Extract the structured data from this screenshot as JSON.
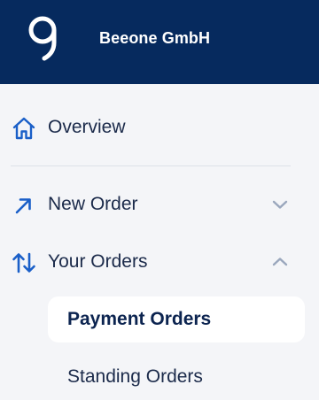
{
  "header": {
    "company_name": "Beeone GmbH",
    "logo_icon": "beeone-logo-icon"
  },
  "nav": {
    "items": [
      {
        "label": "Overview",
        "icon": "home-icon"
      },
      {
        "label": "New Order",
        "icon": "arrow-up-right-icon",
        "chevron": "chevron-down-icon",
        "expanded": false
      },
      {
        "label": "Your Orders",
        "icon": "arrows-up-down-icon",
        "chevron": "chevron-up-icon",
        "expanded": true
      }
    ],
    "sub_items": [
      {
        "label": "Payment Orders",
        "active": true
      },
      {
        "label": "Standing Orders",
        "active": false
      }
    ]
  },
  "colors": {
    "header_bg": "#062a5e",
    "sidebar_bg": "#f4f5f8",
    "icon_accent": "#1a5fc8",
    "text": "#1b2a4a",
    "chevron": "#9aa7bd",
    "active_bg": "#ffffff"
  }
}
